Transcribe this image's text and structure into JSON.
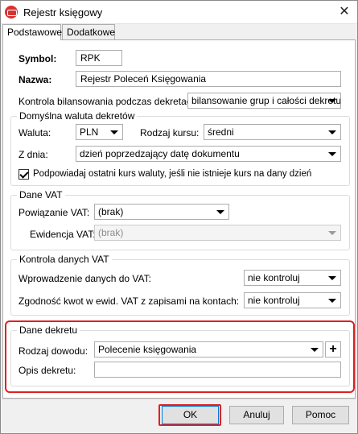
{
  "window": {
    "title": "Rejestr księgowy",
    "close_glyph": "✕"
  },
  "tabs": [
    {
      "label": "Podstawowe",
      "active": true
    },
    {
      "label": "Dodatkowe",
      "active": false
    }
  ],
  "fields": {
    "symbol": {
      "label": "Symbol:",
      "value": "RPK"
    },
    "nazwa": {
      "label": "Nazwa:",
      "value": "Rejestr Poleceń Księgowania"
    },
    "kontrola_bilansowania": {
      "label": "Kontrola bilansowania podczas dekretacji:",
      "value": "bilansowanie grup i całości dekretu"
    }
  },
  "waluta_group": {
    "title": "Domyślna waluta dekretów",
    "waluta": {
      "label": "Waluta:",
      "value": "PLN"
    },
    "rodzaj_kursu": {
      "label": "Rodzaj kursu:",
      "value": "średni"
    },
    "z_dnia": {
      "label": "Z dnia:",
      "value": "dzień poprzedzający datę dokumentu"
    },
    "checkbox": {
      "label": "Podpowiadaj ostatni kurs waluty, jeśli nie istnieje kurs na dany dzień",
      "checked": true
    }
  },
  "vat_group": {
    "title": "Dane VAT",
    "powiazanie": {
      "label": "Powiązanie VAT:",
      "value": "(brak)"
    },
    "ewidencja": {
      "label": "Ewidencja VAT:",
      "value": "(brak)"
    }
  },
  "kontrola_vat_group": {
    "title": "Kontrola danych VAT",
    "wprowadzenie": {
      "label": "Wprowadzenie danych do VAT:",
      "value": "nie kontroluj"
    },
    "zgodnosc": {
      "label": "Zgodność kwot w ewid. VAT z zapisami na kontach:",
      "value": "nie kontroluj"
    }
  },
  "dekret_group": {
    "title": "Dane dekretu",
    "rodzaj_dowodu": {
      "label": "Rodzaj dowodu:",
      "value": "Polecenie księgowania"
    },
    "plus": "+",
    "opis": {
      "label": "Opis dekretu:",
      "value": ""
    }
  },
  "buttons": {
    "ok": "OK",
    "anuluj": "Anuluj",
    "pomoc": "Pomoc"
  },
  "colors": {
    "highlight": "#e0201f",
    "icon": "#d8322f"
  }
}
